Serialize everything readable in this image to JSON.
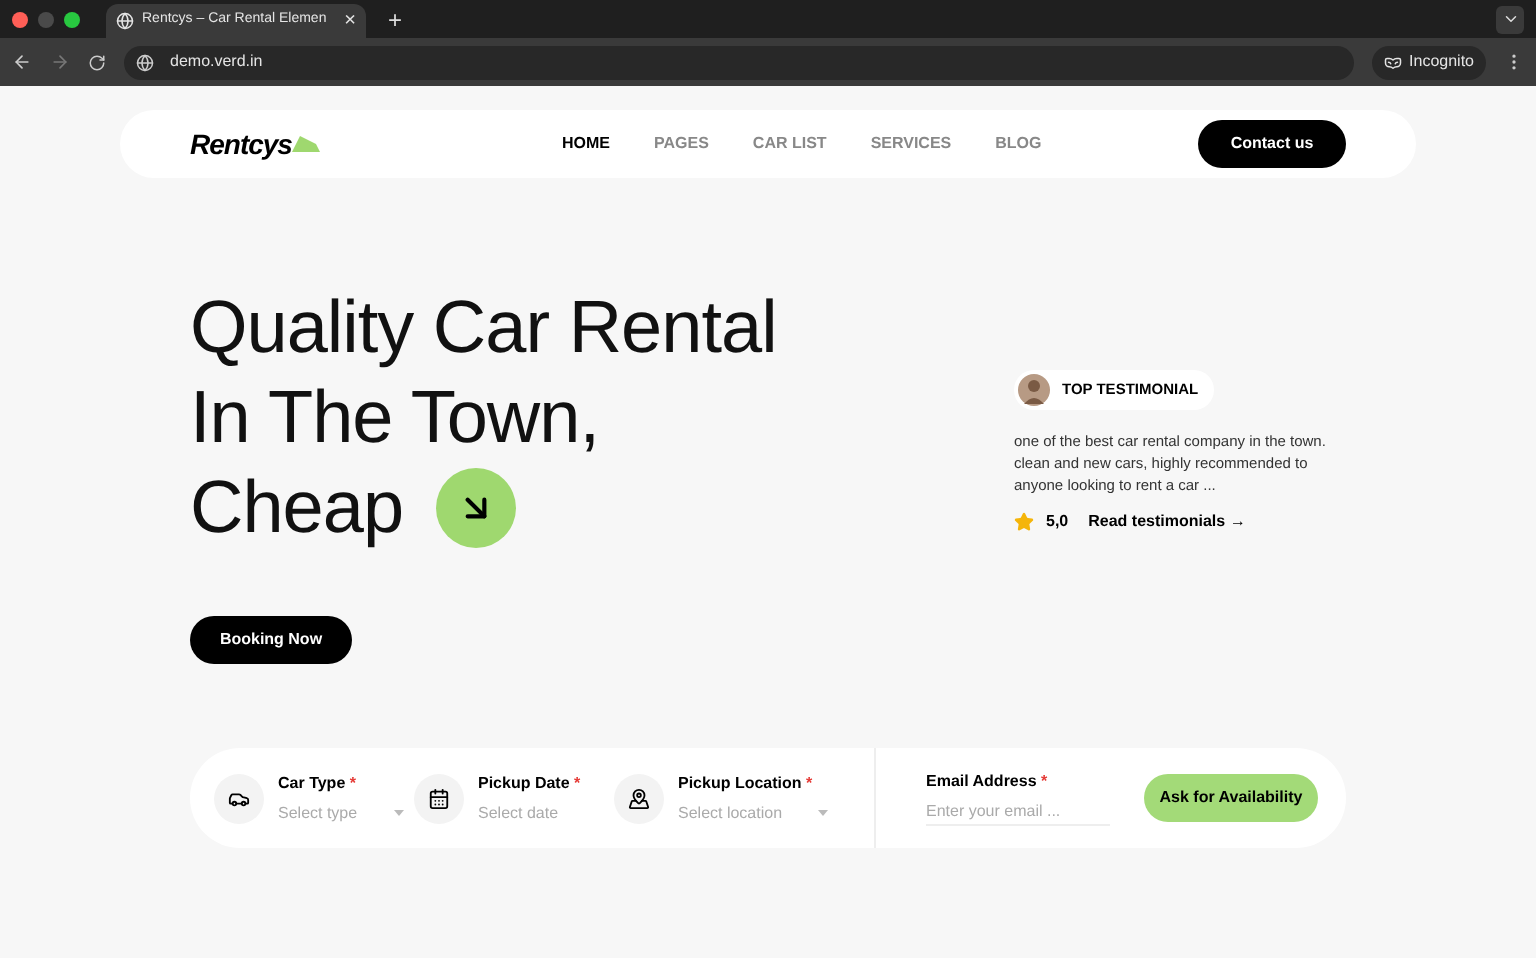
{
  "browser": {
    "tab_title": "Rentcys – Car Rental Elemen",
    "tab_close": "×",
    "new_tab": "+",
    "url": "demo.verd.in",
    "incognito": "Incognito"
  },
  "nav": {
    "logo": "Rentcys",
    "links": [
      {
        "label": "HOME",
        "selected": true
      },
      {
        "label": "PAGES",
        "selected": false
      },
      {
        "label": "CAR LIST",
        "selected": false
      },
      {
        "label": "SERVICES",
        "selected": false
      },
      {
        "label": "BLOG",
        "selected": false
      }
    ],
    "cta": "Contact us"
  },
  "hero": {
    "lines": [
      "Quality Car Rental",
      "In The Town,",
      "Cheap"
    ],
    "button": "Booking Now"
  },
  "testimonial": {
    "badge": "TOP TESTIMONIAL",
    "text": "one of the best car rental company in the town. clean and new cars, highly recommended to anyone looking to rent a car ...",
    "rating": "5,0",
    "link": "Read testimonials →"
  },
  "search": {
    "fields": [
      {
        "kind": "select",
        "label": "Car Type",
        "mark": "*",
        "placeholder": "Select type"
      },
      {
        "kind": "date",
        "label": "Pickup Date",
        "mark": "*",
        "placeholder": "Select date"
      },
      {
        "kind": "select",
        "label": "Pickup Location",
        "mark": "*",
        "placeholder": "Select location"
      }
    ],
    "email": {
      "label": "Email Address",
      "mark": "*",
      "placeholder": "Enter your email ..."
    },
    "button": "Ask for Availability"
  }
}
